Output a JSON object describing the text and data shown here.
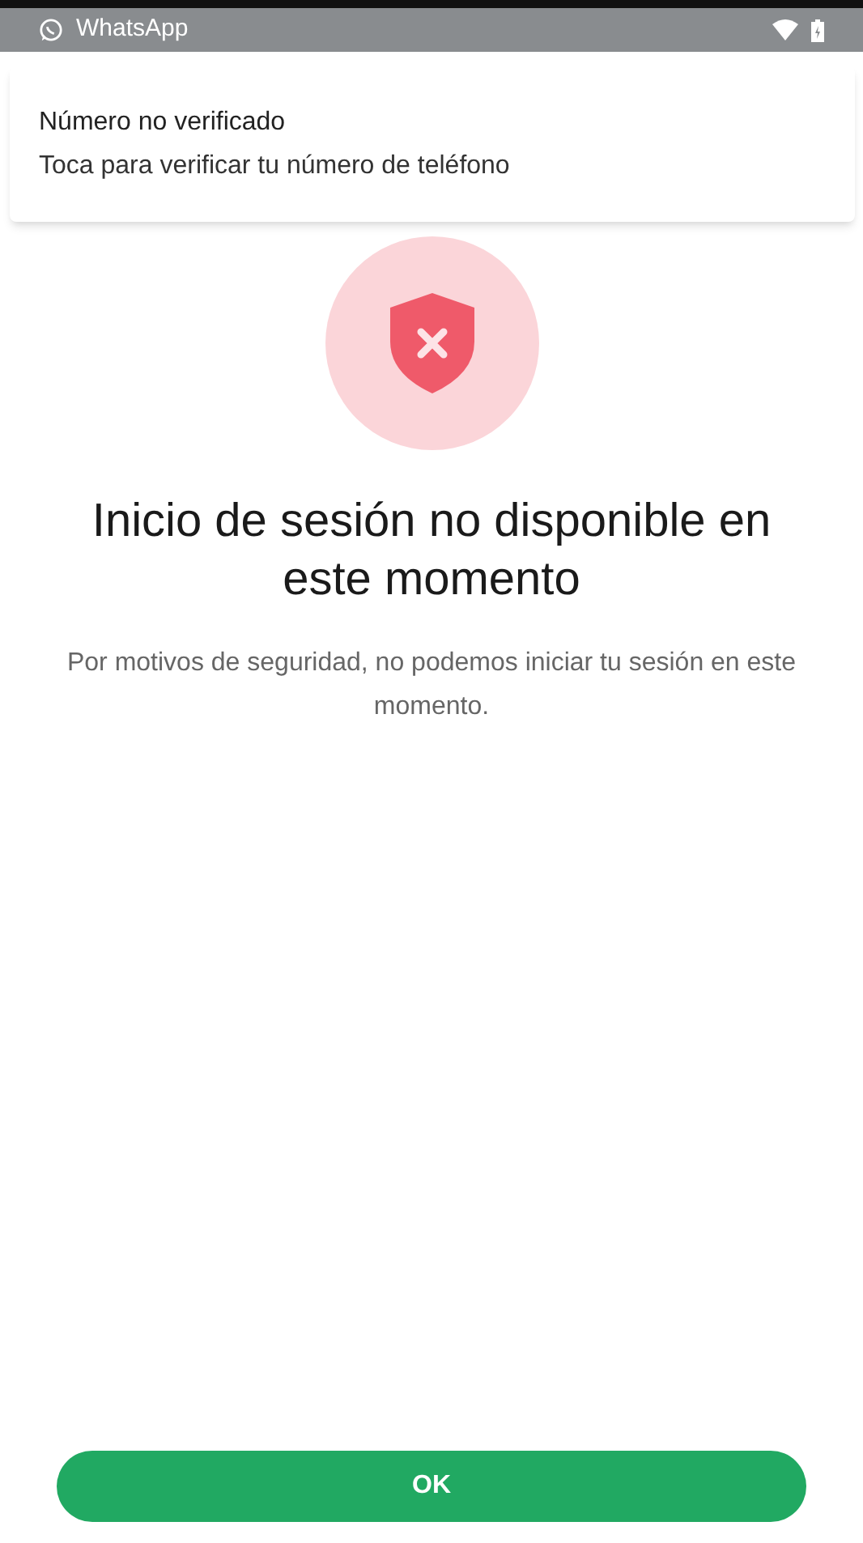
{
  "status_bar": {
    "app_name": "WhatsApp"
  },
  "notification": {
    "title": "Número no verificado",
    "text": "Toca para verificar tu número de teléfono"
  },
  "title": "Inicio de sesión no disponible en este momento",
  "message": "Por motivos de seguridad, no podemos iniciar tu sesión en este momento.",
  "button": "OK"
}
